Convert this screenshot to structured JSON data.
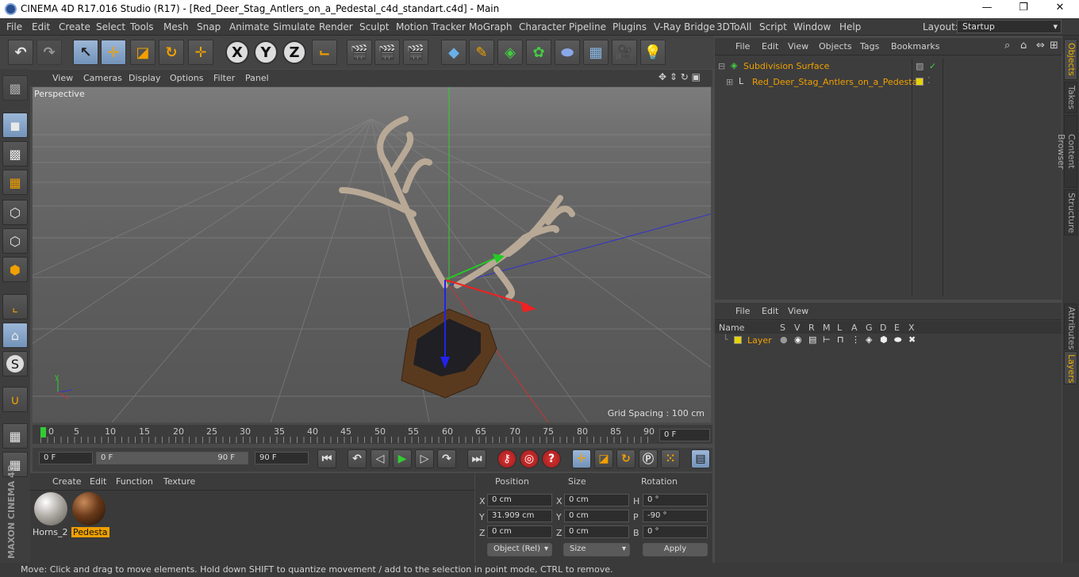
{
  "window": {
    "title": "CINEMA 4D R17.016 Studio (R17) - [Red_Deer_Stag_Antlers_on_a_Pedestal_c4d_standart.c4d] - Main",
    "min": "—",
    "max": "❐",
    "close": "✕"
  },
  "menu": [
    "File",
    "Edit",
    "Create",
    "Select",
    "Tools",
    "Mesh",
    "Snap",
    "Animate",
    "Simulate",
    "Render",
    "Sculpt",
    "Motion Tracker",
    "MoGraph",
    "Character",
    "Pipeline",
    "Plugins",
    "V-Ray Bridge",
    "3DToAll",
    "Script",
    "Window",
    "Help"
  ],
  "layout": {
    "label": "Layout:",
    "value": "Startup"
  },
  "viewport": {
    "menu": [
      "View",
      "Cameras",
      "Display",
      "Options",
      "Filter",
      "Panel"
    ],
    "label": "Perspective",
    "grid_spacing": "Grid Spacing : 100 cm"
  },
  "timeline": {
    "ticks": [
      "0",
      "5",
      "10",
      "15",
      "20",
      "25",
      "30",
      "35",
      "40",
      "45",
      "50",
      "55",
      "60",
      "65",
      "70",
      "75",
      "80",
      "85",
      "90"
    ],
    "end_field": "0 F"
  },
  "transport": {
    "start": "0 F",
    "range_start": "0 F",
    "range_end": "90 F",
    "end": "90 F"
  },
  "materials": {
    "menu": [
      "Create",
      "Edit",
      "Function",
      "Texture"
    ],
    "items": [
      {
        "name": "Horns_2"
      },
      {
        "name": "Pedesta"
      }
    ]
  },
  "attributes": {
    "headers": [
      "Position",
      "Size",
      "Rotation"
    ],
    "rows": [
      {
        "pl": "X",
        "pv": "0 cm",
        "sl": "X",
        "sv": "0 cm",
        "rl": "H",
        "rv": "0 °"
      },
      {
        "pl": "Y",
        "pv": "31.909 cm",
        "sl": "Y",
        "sv": "0 cm",
        "rl": "P",
        "rv": "-90 °"
      },
      {
        "pl": "Z",
        "pv": "0 cm",
        "sl": "Z",
        "sv": "0 cm",
        "rl": "B",
        "rv": "0 °"
      }
    ],
    "mode": "Object (Rel)",
    "size_mode": "Size",
    "apply": "Apply"
  },
  "objects": {
    "menu": [
      "File",
      "Edit",
      "View",
      "Objects",
      "Tags",
      "Bookmarks"
    ],
    "items": [
      "Subdivision Surface",
      "Red_Deer_Stag_Antlers_on_a_Pedestal"
    ]
  },
  "layers": {
    "menu": [
      "File",
      "Edit",
      "View"
    ],
    "columns": [
      "Name",
      "S",
      "V",
      "R",
      "M",
      "L",
      "A",
      "G",
      "D",
      "E",
      "X"
    ],
    "items": [
      "Layer"
    ]
  },
  "side_tabs": [
    "Objects",
    "Takes",
    "Content Browser",
    "Structure",
    "Attributes",
    "Layers"
  ],
  "status": "Move: Click and drag to move elements. Hold down SHIFT to quantize movement / add to the selection in point mode, CTRL to remove.",
  "brand": "MAXON CINEMA 4D"
}
